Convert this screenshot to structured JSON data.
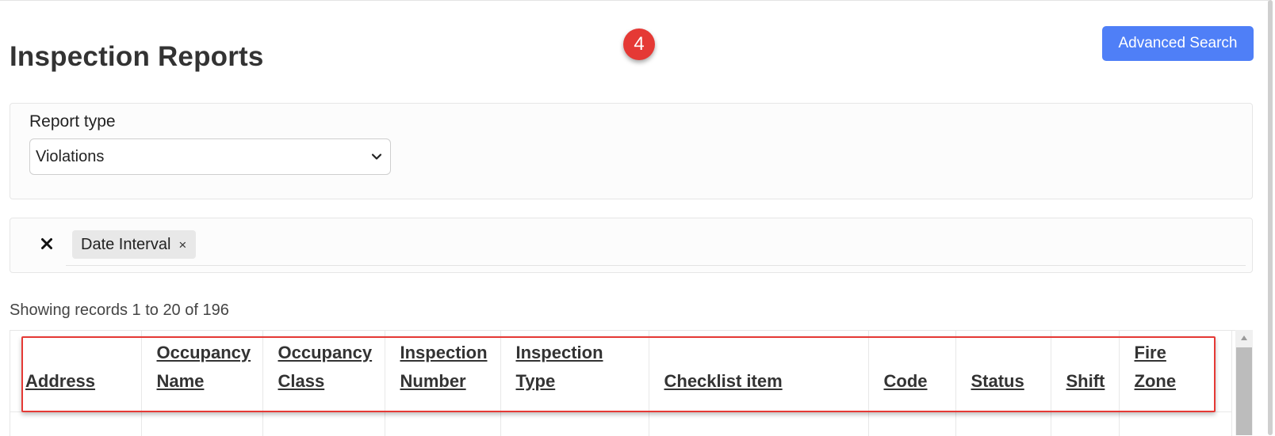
{
  "page": {
    "title": "Inspection Reports",
    "step_badge": "4",
    "advanced_search_label": "Advanced Search"
  },
  "report_type": {
    "label": "Report type",
    "selected": "Violations"
  },
  "filters": {
    "clear_icon": "close-icon",
    "chips": [
      {
        "label": "Date Interval",
        "remove_icon": "×"
      }
    ]
  },
  "records_info": "Showing records 1 to 20 of 196",
  "table": {
    "columns": [
      {
        "line1": "",
        "line2": "Address"
      },
      {
        "line1": "Occupancy",
        "line2": "Name"
      },
      {
        "line1": "Occupancy",
        "line2": "Class"
      },
      {
        "line1": "Inspection",
        "line2": "Number"
      },
      {
        "line1": "Inspection",
        "line2": "Type"
      },
      {
        "line1": "",
        "line2": "Checklist item"
      },
      {
        "line1": "",
        "line2": "Code"
      },
      {
        "line1": "",
        "line2": "Status"
      },
      {
        "line1": "",
        "line2": "Shift"
      },
      {
        "line1": "Fire",
        "line2": "Zone"
      }
    ]
  },
  "colors": {
    "accent": "#4f7ff7",
    "highlight": "#e53935",
    "badge": "#e53935"
  }
}
